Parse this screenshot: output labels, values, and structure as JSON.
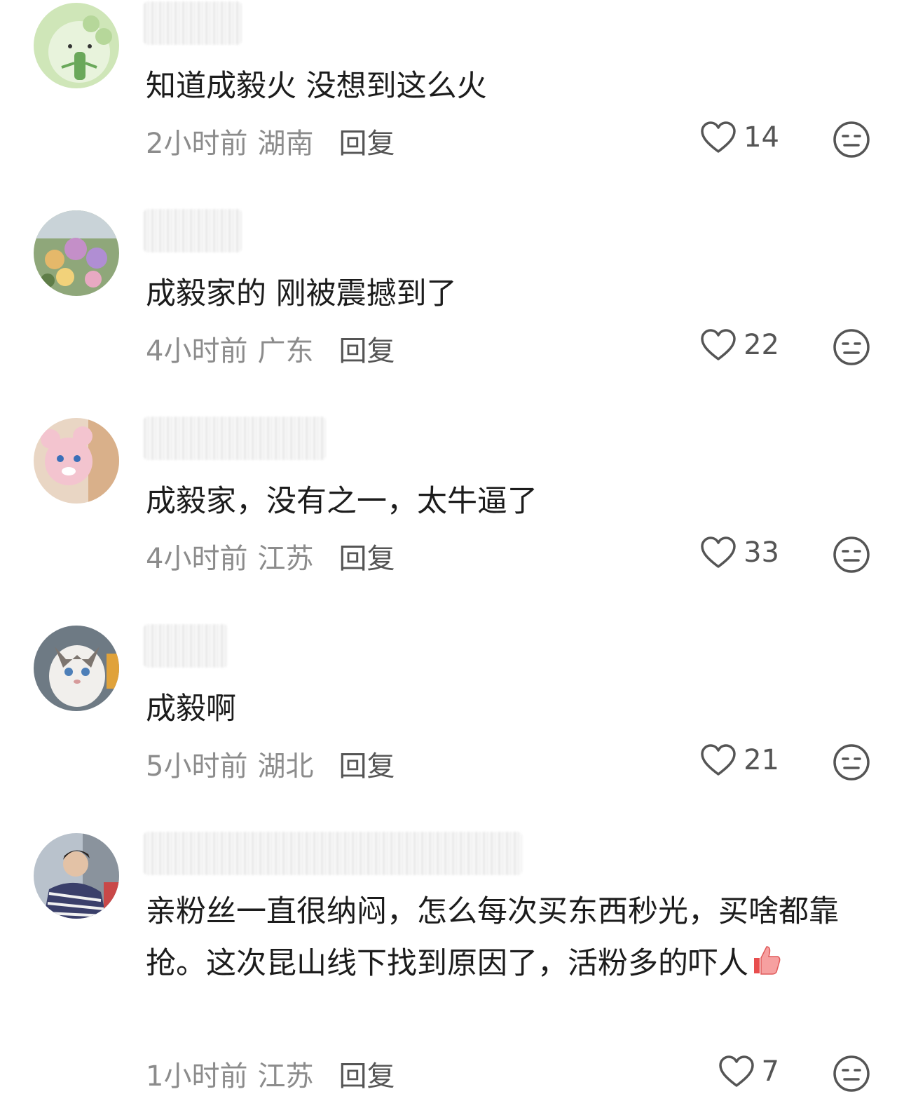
{
  "comments": [
    {
      "text": "知道成毅火 没想到这么火",
      "time": "2小时前",
      "location": "湖南",
      "reply": "回复",
      "likes": "14",
      "avatar": "green-mascot"
    },
    {
      "text": "成毅家的 刚被震撼到了",
      "time": "4小时前",
      "location": "广东",
      "reply": "回复",
      "likes": "22",
      "avatar": "flowers"
    },
    {
      "text": "成毅家，没有之一，太牛逼了",
      "time": "4小时前",
      "location": "江苏",
      "reply": "回复",
      "likes": "33",
      "avatar": "pink-plush"
    },
    {
      "text": "成毅啊",
      "time": "5小时前",
      "location": "湖北",
      "reply": "回复",
      "likes": "21",
      "avatar": "cat"
    },
    {
      "text": "亲粉丝一直很纳闷，怎么每次买东西秒光，买啥都靠抢。这次昆山线下找到原因了，活粉多的吓人",
      "time": "1小时前",
      "location": "江苏",
      "reply": "回复",
      "likes": "7",
      "avatar": "person",
      "emoji": "thumbs-up-emoji"
    }
  ],
  "icons": {
    "like": "heart-outline-icon",
    "dislike": "meh-face-icon"
  },
  "colors": {
    "text": "#1c1c1c",
    "meta": "#8c8c8c",
    "icon": "#555555"
  }
}
